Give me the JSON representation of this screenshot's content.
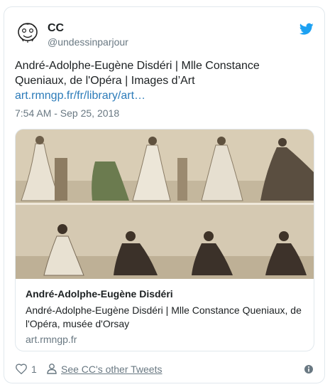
{
  "author": {
    "name": "CC",
    "handle": "@undessinparjour"
  },
  "tweet": {
    "text": "André-Adolphe-Eugène Disdéri | Mlle Constance Queniaux, de l'Opéra | Images d’Art",
    "link": "art.rmngp.fr/fr/library/art…",
    "timestamp": "7:54 AM - Sep 25, 2018"
  },
  "card": {
    "title": "André-Adolphe-Eugène Disdéri",
    "description": "André-Adolphe-Eugène Disdéri | Mlle Constance Queniaux, de l'Opéra, musée d'Orsay",
    "domain": "art.rmngp.fr"
  },
  "actions": {
    "like_count": "1",
    "see_more": "See CC's other Tweets"
  },
  "colors": {
    "link": "#2b7bb9",
    "twitter_blue": "#1da1f2",
    "secondary_text": "#697882",
    "border": "#e1e8ed"
  }
}
